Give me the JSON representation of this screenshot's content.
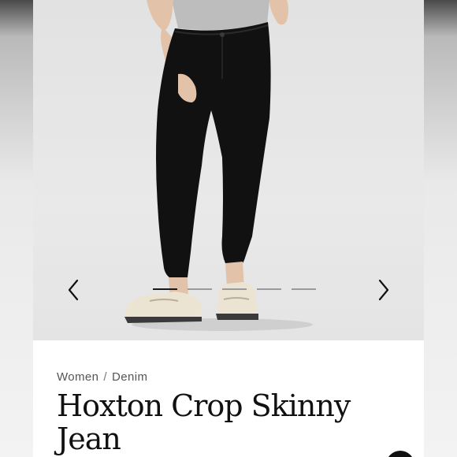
{
  "product": {
    "breadcrumb": {
      "category": "Women",
      "separator": "/",
      "subcategory": "Denim"
    },
    "title": "Hoxton Crop Skinny Jean"
  },
  "carousel": {
    "prev_icon": "chevron-left-icon",
    "next_icon": "chevron-right-icon",
    "slide_count": 5,
    "active_slide": 1
  },
  "colors": {
    "denim": "#111111",
    "background": "#e8e8e8",
    "top": "#bdbdbd",
    "loafer": "#ece4d2"
  }
}
